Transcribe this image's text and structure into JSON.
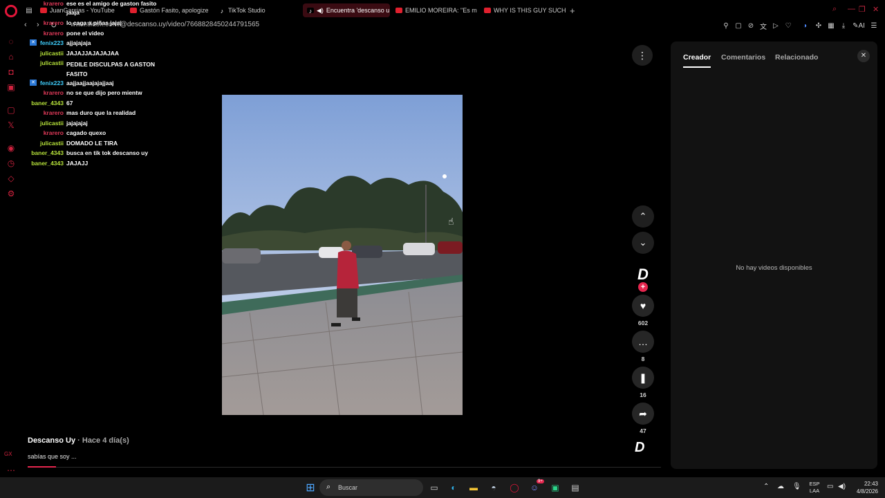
{
  "colors": {
    "accent": "#e5264e",
    "opera_red": "#e3163a",
    "panel_bg": "#121212"
  },
  "tabs": [
    {
      "label": "JuanGarcias - YouTube",
      "favicon": "youtube-icon"
    },
    {
      "label": "Gastón Fasito, apologize -",
      "favicon": "youtube-icon"
    },
    {
      "label": "TikTok Studio",
      "favicon": "tiktok-icon"
    },
    {
      "label": "Encuentra 'descanso u",
      "favicon": "tiktok-icon",
      "active": true
    },
    {
      "label": "EMILIO MOREIRA: \"Es muy",
      "favicon": "youtube-icon"
    },
    {
      "label": "WHY IS THIS GUY SUCH A",
      "favicon": "youtube-icon"
    }
  ],
  "address": {
    "url": "www.tiktok.com/@descanso.uy/video/7668828450244791565"
  },
  "chat": [
    {
      "user": "krarero",
      "color": "#e23a5a",
      "msg": "ese es el amigo de gaston fasito"
    },
    {
      "user": "jaaja",
      "color": "#ffffff",
      "msg": ""
    },
    {
      "user": "krarero",
      "color": "#e23a5a",
      "msg": "lo caga a piñas jajaj"
    },
    {
      "user": "krarero",
      "color": "#e23a5a",
      "msg": "pone el video"
    },
    {
      "user": "fenix223",
      "color": "#3fd0ff",
      "msg": "ajjajajaja",
      "badge": true
    },
    {
      "user": "julicastii",
      "color": "#b6e23a",
      "msg": "JAJAJJAJAJAJAA"
    },
    {
      "user": "julicastii",
      "color": "#b6e23a",
      "msg": "PEDILE DISCULPAS A GASTON FASITO"
    },
    {
      "user": "fenix223",
      "color": "#3fd0ff",
      "msg": "aajjaajjaajajajjaaj",
      "badge": true
    },
    {
      "user": "krarero",
      "color": "#e23a5a",
      "msg": "no se que dijo pero mientw"
    },
    {
      "user": "baner_4343",
      "color": "#b6e23a",
      "msg": "67"
    },
    {
      "user": "krarero",
      "color": "#e23a5a",
      "msg": "mas duro que la realidad"
    },
    {
      "user": "julicastii",
      "color": "#b6e23a",
      "msg": "jajajajaj"
    },
    {
      "user": "krarero",
      "color": "#e23a5a",
      "msg": "cagado quexo"
    },
    {
      "user": "julicastii",
      "color": "#b6e23a",
      "msg": "DOMADO LE TIRA"
    },
    {
      "user": "baner_4343",
      "color": "#b6e23a",
      "msg": "busca en tik tok descanso uy"
    },
    {
      "user": "baner_4343",
      "color": "#b6e23a",
      "msg": "JAJAJJ"
    }
  ],
  "video": {
    "creator": "Descanso Uy",
    "time_ago": "· Hace 4 día(s)",
    "caption": "sabías que soy ...",
    "progress": 0.045
  },
  "actions": {
    "likes": "602",
    "comments": "8",
    "saves": "16",
    "shares": "47"
  },
  "panel": {
    "tabs": [
      "Creador",
      "Comentarios",
      "Relacionado"
    ],
    "active_tab": "Creador",
    "empty_message": "No hay videos disponibles"
  },
  "taskbar": {
    "search_label": "Buscar",
    "language": "ESP",
    "layout": "LAA",
    "time": "22:43",
    "date": "4/8/2026",
    "discord_badge": "9+"
  },
  "sidebar": {
    "label_bottom": "GX"
  }
}
